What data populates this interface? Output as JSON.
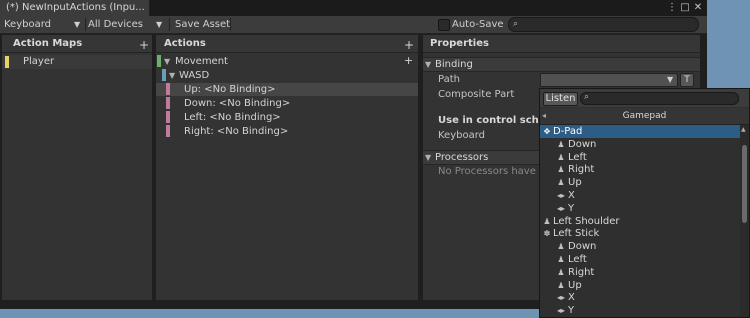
{
  "window": {
    "tab_title": "(*) NewInputActions (Inpu...",
    "menu_icon": "⋮",
    "maximize_icon": "□",
    "close_icon": "✕"
  },
  "toolbar": {
    "scheme": "Keyboard",
    "devices": "All Devices",
    "save_asset": "Save Asset",
    "auto_save": "Auto-Save",
    "auto_save_checked": false,
    "search_value": ""
  },
  "action_maps": {
    "header": "Action Maps",
    "add": "+",
    "items": [
      {
        "label": "Player",
        "color": "#e6d06a"
      }
    ]
  },
  "actions": {
    "header": "Actions",
    "add": "+",
    "add_binding": "+",
    "action": {
      "label": "Movement",
      "color": "#6ab06a"
    },
    "composite": {
      "label": "WASD",
      "color": "#6a9fb8"
    },
    "bindings": [
      {
        "label": "Up: <No Binding>",
        "color": "#c07a9a"
      },
      {
        "label": "Down: <No Binding>",
        "color": "#c07a9a"
      },
      {
        "label": "Left: <No Binding>",
        "color": "#c07a9a"
      },
      {
        "label": "Right: <No Binding>",
        "color": "#c07a9a"
      }
    ]
  },
  "properties": {
    "header": "Properties",
    "binding_section": "Binding",
    "path_label": "Path",
    "path_value": "",
    "t_button": "T",
    "composite_part_label": "Composite Part",
    "control_scheme_label": "Use in control scheme",
    "keyboard_label": "Keyboard",
    "processors_section": "Processors",
    "no_processors": "No Processors have been added"
  },
  "popup": {
    "listen": "Listen",
    "search_value": "",
    "nav_back": "◂",
    "category": "Gamepad",
    "items": [
      {
        "label": "D-Pad",
        "icon": "dpad-icon",
        "glyph": "✥",
        "indent": 0,
        "selected": true
      },
      {
        "label": "Down",
        "icon": "button-icon",
        "glyph": "♟",
        "indent": 1
      },
      {
        "label": "Left",
        "icon": "button-icon",
        "glyph": "♟",
        "indent": 1
      },
      {
        "label": "Right",
        "icon": "button-icon",
        "glyph": "♟",
        "indent": 1
      },
      {
        "label": "Up",
        "icon": "button-icon",
        "glyph": "♟",
        "indent": 1
      },
      {
        "label": "X",
        "icon": "axis-icon",
        "glyph": "◂▸",
        "indent": 1
      },
      {
        "label": "Y",
        "icon": "axis-icon",
        "glyph": "◂▸",
        "indent": 1
      },
      {
        "label": "Left Shoulder",
        "icon": "button-icon",
        "glyph": "♟",
        "indent": 0
      },
      {
        "label": "Left Stick",
        "icon": "stick-icon",
        "glyph": "✽",
        "indent": 0
      },
      {
        "label": "Down",
        "icon": "button-icon",
        "glyph": "♟",
        "indent": 1
      },
      {
        "label": "Left",
        "icon": "button-icon",
        "glyph": "♟",
        "indent": 1
      },
      {
        "label": "Right",
        "icon": "button-icon",
        "glyph": "♟",
        "indent": 1
      },
      {
        "label": "Up",
        "icon": "button-icon",
        "glyph": "♟",
        "indent": 1
      },
      {
        "label": "X",
        "icon": "axis-icon",
        "glyph": "◂▸",
        "indent": 1
      },
      {
        "label": "Y",
        "icon": "axis-icon",
        "glyph": "◂▸",
        "indent": 1
      }
    ]
  }
}
